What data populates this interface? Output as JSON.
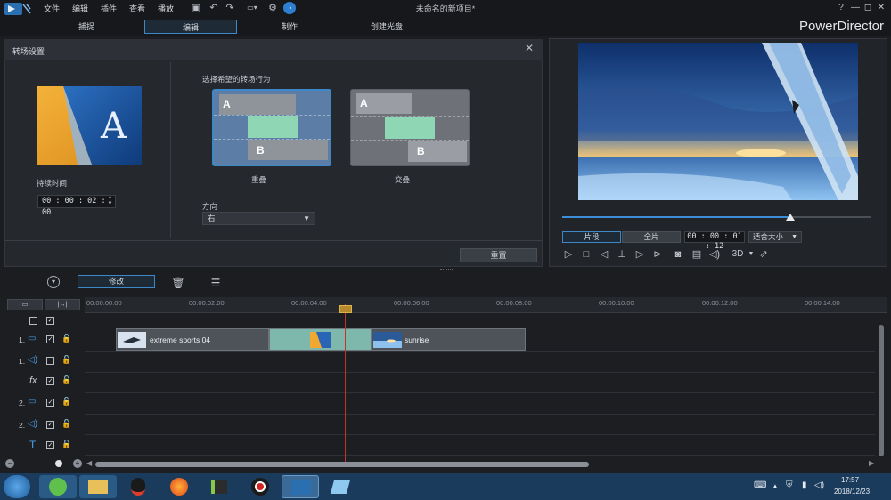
{
  "menu": [
    "文件",
    "编辑",
    "插件",
    "查看",
    "播放"
  ],
  "window_title": "未命名的新项目*",
  "window_controls": {
    "help": "?",
    "minimize": "—",
    "restore": "◻",
    "close": "✕"
  },
  "tabs": [
    {
      "label": "捕捉",
      "active": false
    },
    {
      "label": "编辑",
      "active": true
    },
    {
      "label": "制作",
      "active": false
    },
    {
      "label": "创建光盘",
      "active": false
    }
  ],
  "brand": "PowerDirector",
  "transition_panel": {
    "title": "转场设置",
    "duration_label": "持续时间",
    "duration_value": "00 : 00 : 02 : 00",
    "behavior_label": "选择希望的转场行为",
    "options": [
      {
        "label": "重叠",
        "selected": true,
        "a": "A",
        "b": "B"
      },
      {
        "label": "交叠",
        "selected": false,
        "a": "A",
        "b": "B"
      }
    ],
    "direction_label": "方向",
    "direction_value": "右",
    "reset_label": "重置"
  },
  "preview": {
    "progress": 0.74,
    "clip_label": "片段",
    "full_label": "全片",
    "timecode": "00 : 00 : 01 : 12",
    "fit_label": "适合大小",
    "three_d_label": "3D"
  },
  "toolbar": {
    "modify_label": "修改"
  },
  "timeline": {
    "ruler_labels": [
      "00:00:00:00",
      "00:00:02:00",
      "00:00:04:00",
      "00:00:06:00",
      "00:00:08:00",
      "00:00:10:00",
      "00:00:12:00",
      "00:00:14:00"
    ],
    "tracks": [
      {
        "num": "1.",
        "type": "video"
      },
      {
        "num": "1.",
        "type": "audio"
      },
      {
        "num": "",
        "type": "fx",
        "label": "fx"
      },
      {
        "num": "2.",
        "type": "video"
      },
      {
        "num": "2.",
        "type": "audio"
      },
      {
        "num": "",
        "type": "title",
        "label": "T"
      }
    ],
    "clips": [
      {
        "name": "extreme sports 04"
      },
      {
        "name": "sunrise"
      }
    ]
  },
  "taskbar": {
    "time": "17:57",
    "date": "2018/12/23"
  },
  "colors": {
    "accent": "#3c88c8",
    "playhead": "#c8312b",
    "transition": "#8fd6b4"
  }
}
